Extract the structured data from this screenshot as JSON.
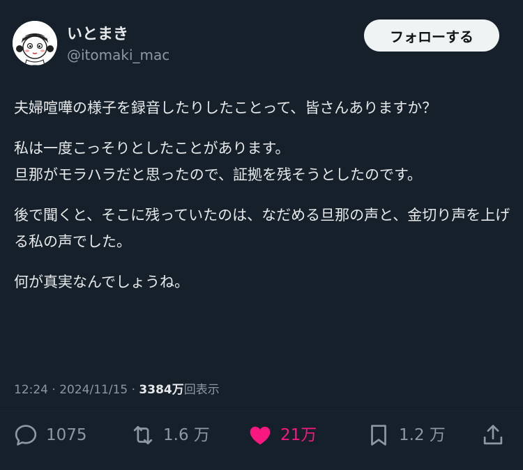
{
  "user": {
    "display_name": "いとまき",
    "handle": "@itomaki_mac"
  },
  "follow_button": {
    "label": "フォローする"
  },
  "post": {
    "paragraphs": [
      "夫婦喧嘩の様子を録音したりしたことって、皆さんありますか？",
      "私は一度こっそりとしたことがあります。\n旦那がモラハラだと思ったので、証拠を残そうとしたのです。",
      "後で聞くと、そこに残っていたのは、なだめる旦那の声と、金切り声を上げる私の声でした。",
      "何が真実なんでしょうね。"
    ],
    "time": "12:24",
    "date": "2024/11/15",
    "separator": "·",
    "views_count": "3384",
    "views_unit": "万",
    "views_label": "回表示"
  },
  "actions": {
    "reply_count": "1075",
    "repost_count": "1.6 万",
    "like_count": "21万",
    "bookmark_count": "1.2 万"
  },
  "colors": {
    "background": "#15202b",
    "text_primary": "#e7e9ea",
    "text_secondary": "#8b98a5",
    "like_pink": "#f91880",
    "follow_bg": "#eff3f4"
  },
  "icons": {
    "reply": "speech-bubble-icon",
    "repost": "repost-arrows-icon",
    "like": "heart-filled-icon",
    "bookmark": "bookmark-icon",
    "share": "share-upload-icon"
  }
}
